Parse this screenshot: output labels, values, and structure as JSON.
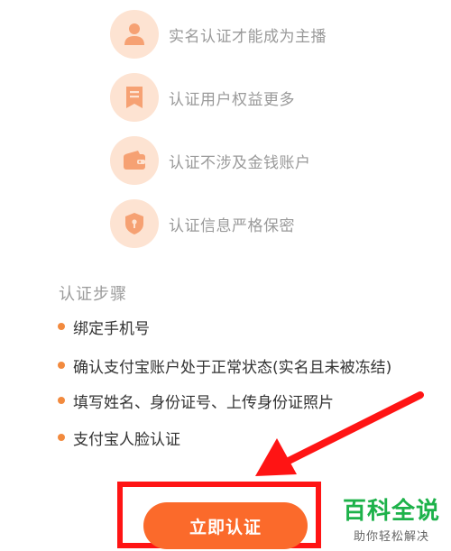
{
  "benefits": [
    {
      "icon": "person-icon",
      "label": "实名认证才能成为主播"
    },
    {
      "icon": "document-bookmark-icon",
      "label": "认证用户权益更多"
    },
    {
      "icon": "wallet-icon",
      "label": "认证不涉及金钱账户"
    },
    {
      "icon": "shield-icon",
      "label": "认证信息严格保密"
    }
  ],
  "steps": {
    "title": "认证步骤",
    "items": [
      "绑定手机号",
      "确认支付宝账户处于正常状态(实名且未被冻结)",
      "填写姓名、身份证号、上传身份证照片",
      "支付宝人脸认证"
    ]
  },
  "action": {
    "verify_label": "立即认证"
  },
  "watermark": {
    "title": "百科全说",
    "subtitle": "助你轻松解决"
  },
  "colors": {
    "accent": "#fb6a2b",
    "icon_bg": "#fde3d2",
    "icon_fg": "#f6a173",
    "bullet": "#f28a3e",
    "annotation_red": "#ff1414",
    "watermark_green": "#1db24a"
  }
}
